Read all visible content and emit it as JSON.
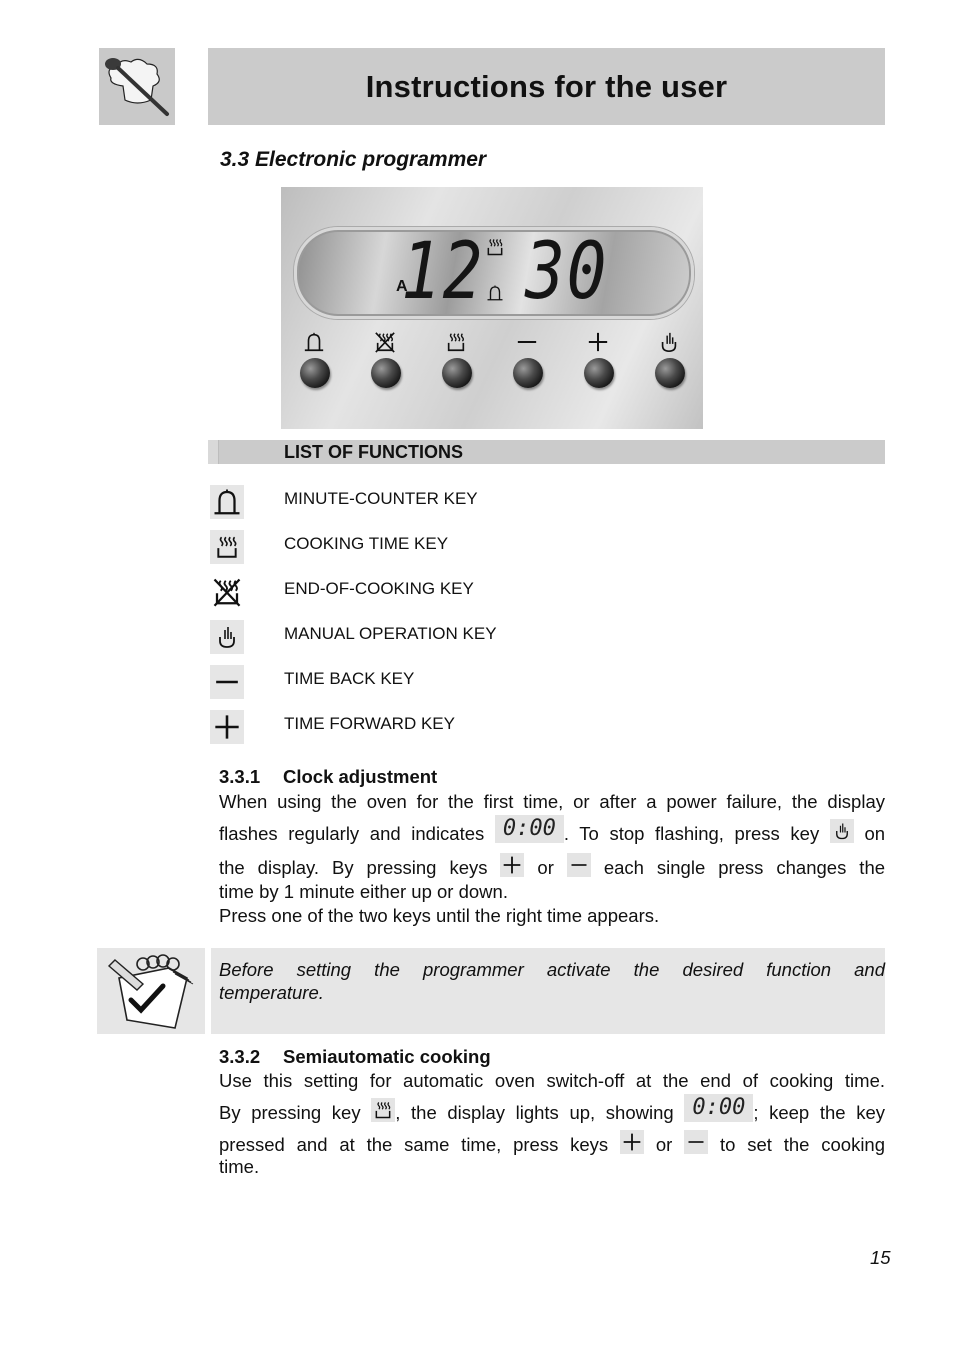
{
  "header": {
    "title": "Instructions for the user",
    "logo_icon": "chef-hat-spoon-icon"
  },
  "section": {
    "title": "3.3 Electronic programmer"
  },
  "panel": {
    "display": {
      "mode_indicator": "A",
      "hours": "12",
      "minutes": "30",
      "indicators": [
        "cooking-time-icon",
        "bell-icon"
      ]
    },
    "keys": [
      {
        "name": "minute-counter",
        "icon": "bell-icon"
      },
      {
        "name": "end-of-cooking",
        "icon": "end-of-cooking-icon"
      },
      {
        "name": "cooking-time",
        "icon": "cooking-time-icon"
      },
      {
        "name": "time-back",
        "icon": "minus-icon"
      },
      {
        "name": "time-forward",
        "icon": "plus-icon"
      },
      {
        "name": "manual-operation",
        "icon": "hand-icon"
      }
    ]
  },
  "functions": {
    "header": "LIST OF FUNCTIONS",
    "items": [
      {
        "icon": "bell-icon",
        "label": "MINUTE-COUNTER KEY"
      },
      {
        "icon": "cooking-time-icon",
        "label": "COOKING TIME KEY"
      },
      {
        "icon": "end-of-cooking-icon",
        "label": "END-OF-COOKING KEY"
      },
      {
        "icon": "hand-icon",
        "label": "MANUAL OPERATION KEY"
      },
      {
        "icon": "minus-icon",
        "label": "TIME BACK KEY"
      },
      {
        "icon": "plus-icon",
        "label": "TIME FORWARD KEY"
      }
    ]
  },
  "clock_adjustment": {
    "number": "3.3.1",
    "title": "Clock adjustment",
    "line1": "When using the oven for the first time, or after a power failure, the display",
    "line2a": "flashes regularly and indicates",
    "display_value": "0:00",
    "line2b": ". To stop flashing, press key",
    "line2c": "on",
    "line3a": "the display. By pressing keys",
    "line3b": "or",
    "line3c": "each single press changes the",
    "line4": "time by 1 minute either up or down.",
    "line5": "Press one of the two keys until the right time appears."
  },
  "note": {
    "icon": "notepad-check-icon",
    "text": "Before setting the programmer activate the desired function and temperature."
  },
  "semiautomatic": {
    "number": "3.3.2",
    "title": "Semiautomatic cooking",
    "line1": "Use this setting for automatic oven switch-off at the end of cooking time.",
    "line2a": "By pressing key",
    "line2b": ", the display lights up, showing",
    "display_value": "0:00",
    "line2c": "; keep the key",
    "line3a": "pressed and at the same time, press keys",
    "line3b": "or",
    "line3c": "to set the cooking",
    "line4": "time."
  },
  "footer": {
    "page_number": "15"
  }
}
